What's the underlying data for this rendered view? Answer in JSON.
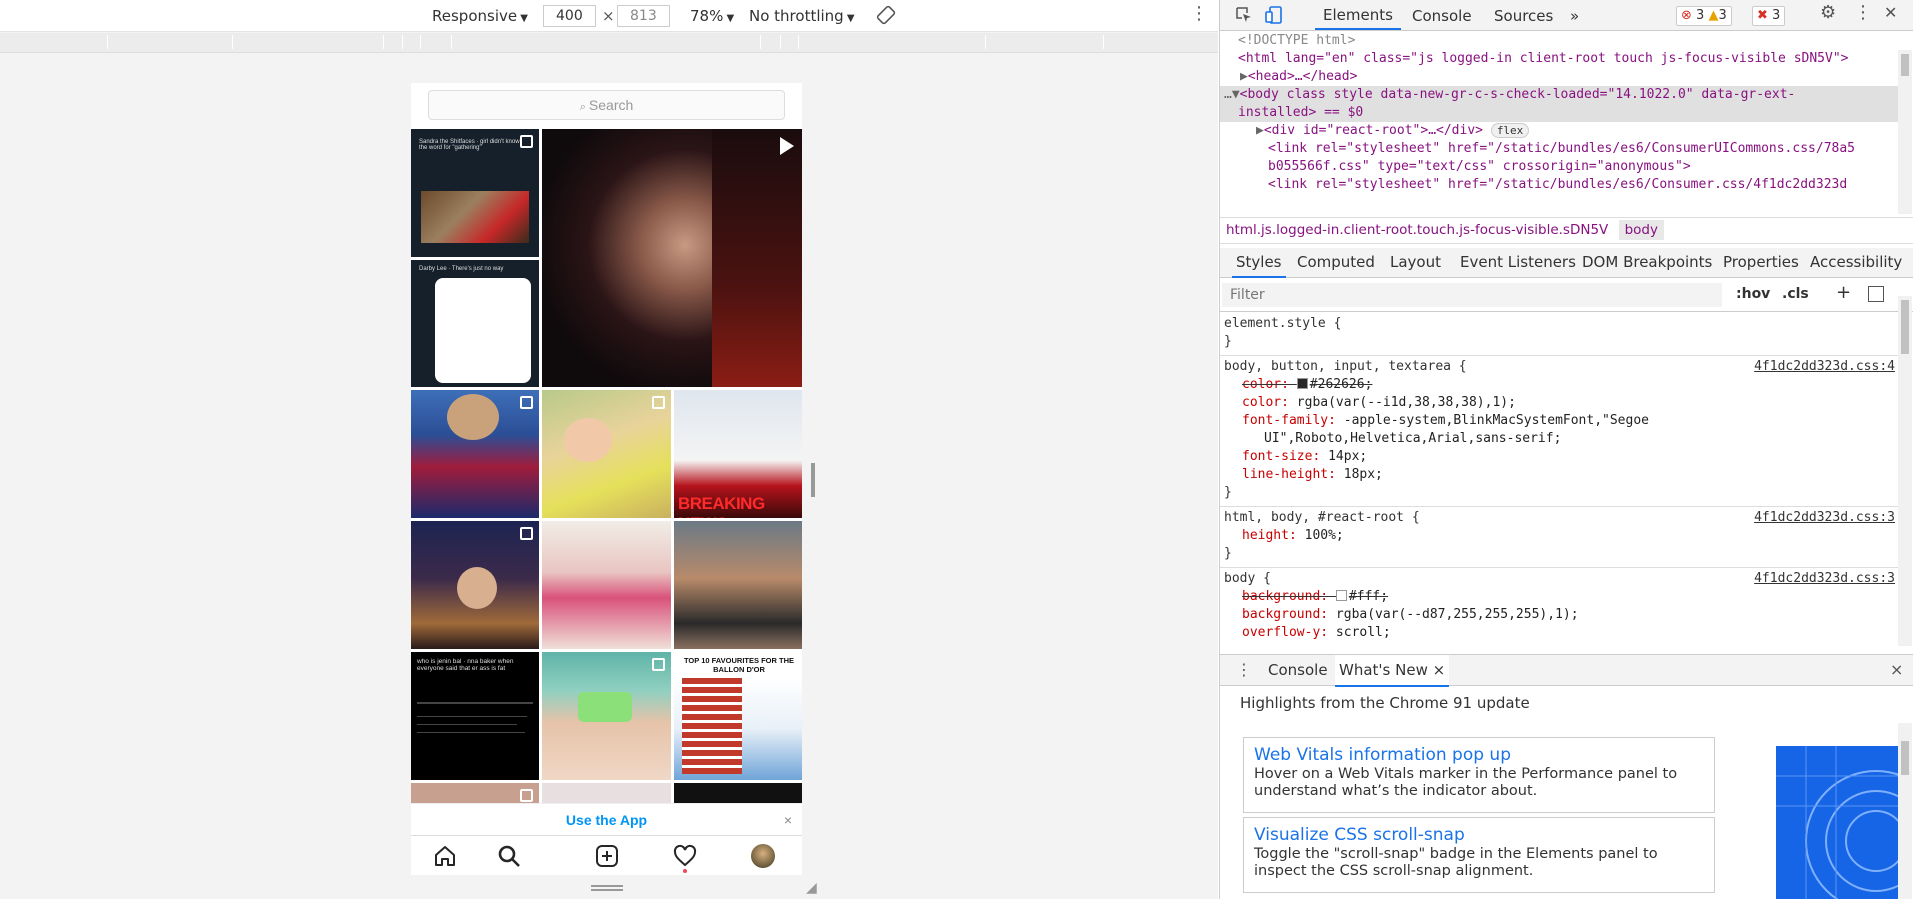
{
  "device_toolbar": {
    "device": "Responsive",
    "width": "400",
    "times": "×",
    "height": "813",
    "zoom": "78%",
    "throttle": "No throttling"
  },
  "phone": {
    "search_placeholder": "Search",
    "use_app": "Use the App",
    "close": "×",
    "tiles": [
      {
        "cap": "Sandra the Shitfaces · girl didn't know the word for \"gathering\""
      },
      {
        "cap": ""
      },
      {
        "cap": "Darby Lee · There's just no way"
      },
      {
        "cap": ""
      },
      {
        "cap": ""
      },
      {
        "cap": "BREAKING NEWS"
      },
      {
        "cap": ""
      },
      {
        "cap": ""
      },
      {
        "cap": ""
      },
      {
        "cap": "who is jenin bal · nna baker when everyone said that er ass is fat"
      },
      {
        "cap": ""
      },
      {
        "cap": "TOP 10 FAVOURITES FOR THE BALLON D'OR"
      }
    ]
  },
  "devtools": {
    "tabs": [
      "Elements",
      "Console",
      "Sources"
    ],
    "more": "»",
    "errors": "3",
    "warnings": "3",
    "issues": "3",
    "dom": {
      "doctype": "<!DOCTYPE html>",
      "html_open": "<html lang=\"en\" class=\"js logged-in client-root touch js-focus-visible sDN5V\">",
      "head": "<head>…</head>",
      "body_open": "<body class style data-new-gr-c-s-check-loaded=\"14.1022.0\" data-gr-ext-",
      "body_open2": "installed> == $0",
      "div_root": "<div id=\"react-root\">…</div>",
      "flex": "flex",
      "link1a": "<link rel=\"stylesheet\" href=\"/static/bundles/es6/ConsumerUICommons.css/78a5",
      "link1b": "b055566f.css\" type=\"text/css\" crossorigin=\"anonymous\">",
      "link2": "<link rel=\"stylesheet\" href=\"/static/bundles/es6/Consumer.css/4f1dc2dd323d"
    },
    "breadcrumb": [
      "html.js.logged-in.client-root.touch.js-focus-visible.sDN5V",
      "body"
    ],
    "subtabs": [
      "Styles",
      "Computed",
      "Layout",
      "Event Listeners",
      "DOM Breakpoints",
      "Properties",
      "Accessibility"
    ],
    "filter_placeholder": "Filter",
    "hov": ":hov",
    "cls": ".cls",
    "plus": "+",
    "rules": {
      "r0_sel": "element.style {",
      "close": "}",
      "r1_sel": "body, button, input, textarea {",
      "r1_src": "4f1dc2dd323d.css:4",
      "r1_p1": "color:",
      "r1_v1": "#262626;",
      "r1_p2": "color:",
      "r1_v2": "rgba(var(--i1d,38,38,38),1);",
      "r1_p3": "font-family:",
      "r1_v3": "-apple-system,BlinkMacSystemFont,\"Segoe",
      "r1_v3b": "UI\",Roboto,Helvetica,Arial,sans-serif;",
      "r1_p4": "font-size:",
      "r1_v4": "14px;",
      "r1_p5": "line-height:",
      "r1_v5": "18px;",
      "r2_sel": "html, body, #react-root {",
      "r2_src": "4f1dc2dd323d.css:3",
      "r2_p1": "height:",
      "r2_v1": "100%;",
      "r3_sel": "body {",
      "r3_src": "4f1dc2dd323d.css:3",
      "r3_p1": "background:",
      "r3_v1": "#fff;",
      "r3_p2": "background:",
      "r3_v2": "rgba(var(--d87,255,255,255),1);",
      "r3_p3": "overflow-y:",
      "r3_v3": "scroll;"
    },
    "drawer": {
      "tabs": [
        "Console",
        "What's New"
      ],
      "tab_close": "×",
      "close": "×",
      "highlights": "Highlights from the Chrome 91 update",
      "cards": [
        {
          "title": "Web Vitals information pop up",
          "desc": "Hover on a Web Vitals marker in the Performance panel to understand what’s the indicator about."
        },
        {
          "title": "Visualize CSS scroll-snap",
          "desc": "Toggle the \"scroll-snap\" badge in the Elements panel to inspect the CSS scroll-snap alignment."
        }
      ]
    }
  }
}
